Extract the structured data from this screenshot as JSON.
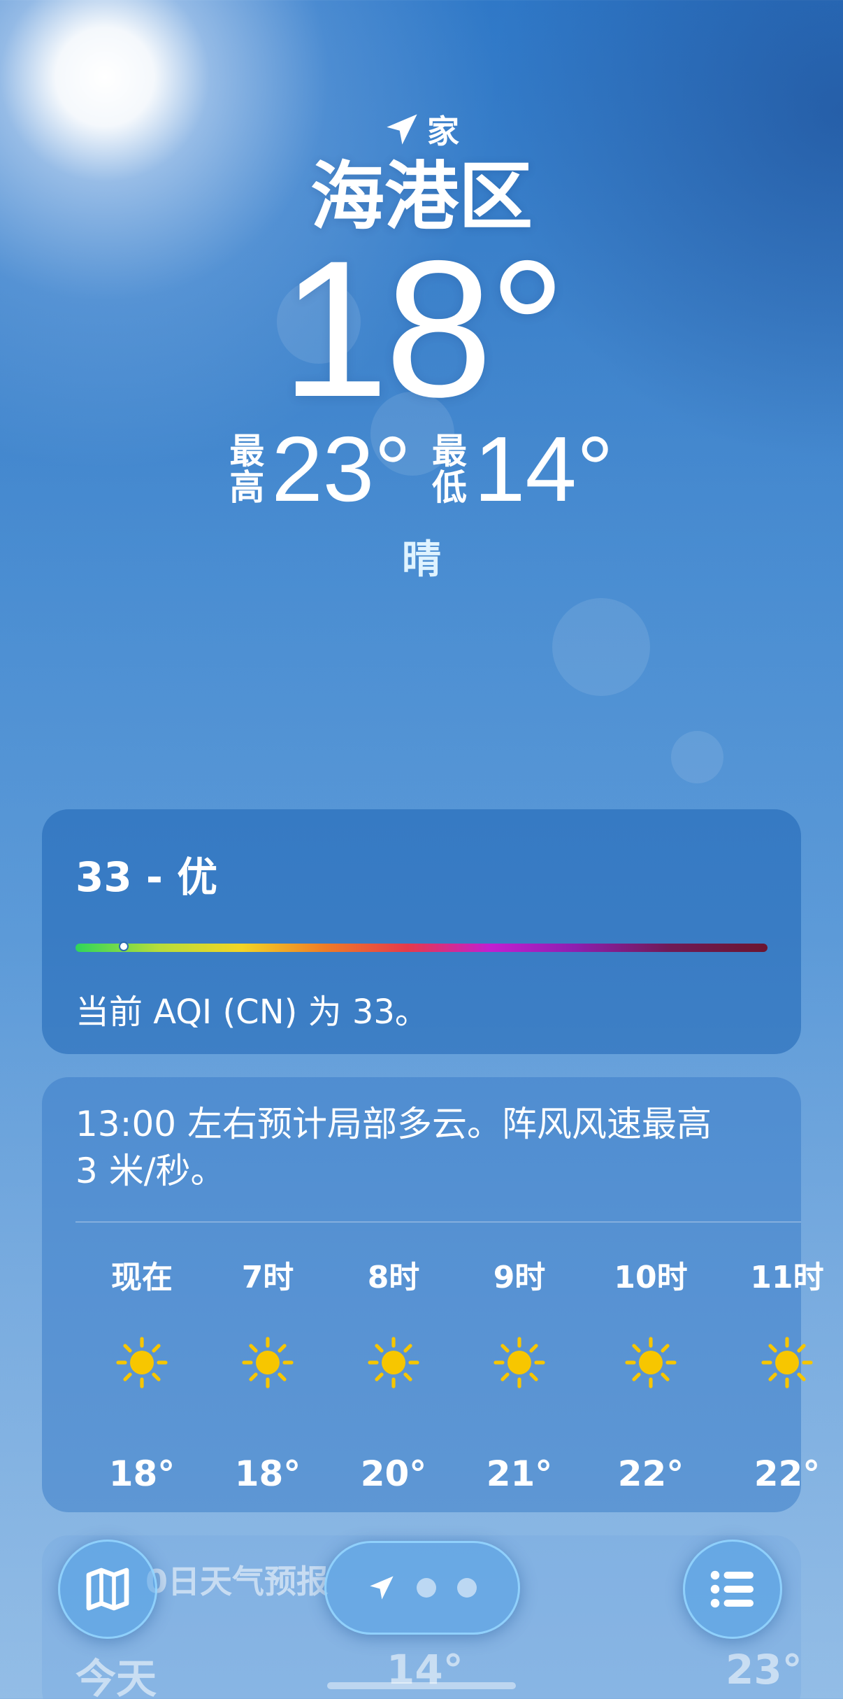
{
  "location": {
    "home_label": "家",
    "city": "海港区"
  },
  "current": {
    "temperature": "18°",
    "high_label": "最高",
    "high": "23°",
    "low_label": "最低",
    "low": "14°",
    "condition": "晴"
  },
  "aqi": {
    "title": "33 - 优",
    "value": 33,
    "indicator_fraction": 0.07,
    "description": "当前 AQI (CN) 为 33。",
    "gradient_colors": [
      "#2fd65a",
      "#f3d525",
      "#ef7c26",
      "#e53a4b",
      "#c21fd1",
      "#6b1530"
    ]
  },
  "hourly": {
    "summary": "13:00 左右预计局部多云。阵风风速最高 3 米/秒。",
    "items": [
      {
        "label": "现在",
        "icon": "sun-icon",
        "temp": "18°"
      },
      {
        "label": "7时",
        "icon": "sun-icon",
        "temp": "18°"
      },
      {
        "label": "8时",
        "icon": "sun-icon",
        "temp": "20°"
      },
      {
        "label": "9时",
        "icon": "sun-icon",
        "temp": "21°"
      },
      {
        "label": "10时",
        "icon": "sun-icon",
        "temp": "22°"
      },
      {
        "label": "11时",
        "icon": "sun-icon",
        "temp": "22°"
      }
    ]
  },
  "ten_day": {
    "title_partial": "0日天气预报",
    "first_day": "今天",
    "first_low": "14°",
    "first_high": "23°"
  },
  "toolbar": {
    "map_icon": "map-icon",
    "location_icon": "location-arrow-icon",
    "list_icon": "list-icon"
  },
  "colors": {
    "sun": "#f7c600",
    "card": "#3a80c8"
  }
}
